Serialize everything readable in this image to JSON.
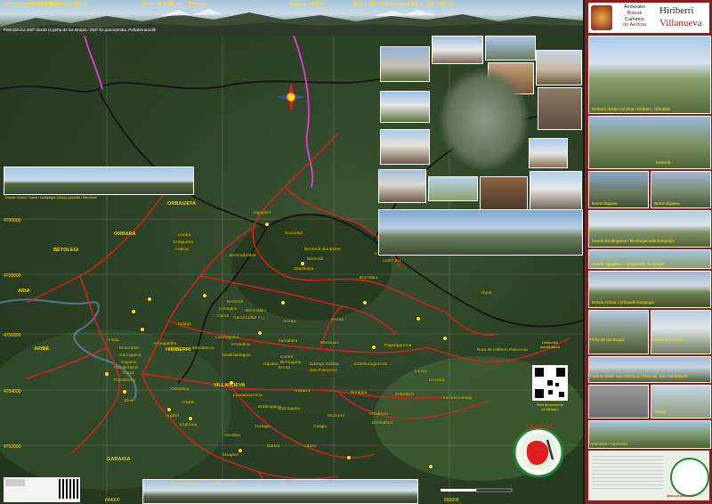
{
  "panorama": {
    "peaks": [
      {
        "name": "Orizanmuneta",
        "alt": "1.308 m"
      },
      {
        "name": "Urkulu",
        "alt": "1.419 m"
      },
      {
        "name": "Mendilaut",
        "alt": "1.252 m"
      },
      {
        "name": "Berrendi",
        "alt": "1.288 m"
      },
      {
        "name": "Pirineos",
        "alt": ""
      },
      {
        "name": "Baigura",
        "alt": "1.478 m"
      },
      {
        "name": "Elke",
        "alt": "1.263 m"
      },
      {
        "name": "La Corona",
        "alt": "1.380 m"
      },
      {
        "name": "Adi",
        "alt": "1.458 m"
      }
    ],
    "caption": "Panorámica 360º desde la peña de las Brujas / 360º ko panoramika, Peñaberaundik"
  },
  "map": {
    "grid_labels": [
      "4760000",
      "4758000",
      "4756000",
      "4754000",
      "4752000",
      "644000",
      "646000",
      "648000",
      "650000"
    ],
    "place_labels": [
      {
        "text": "ORBAIZETA",
        "color": "#ffe400",
        "weight": "bold"
      },
      {
        "text": "ORBARA",
        "color": "#ffe400",
        "weight": "bold"
      },
      {
        "text": "BETOLEGI",
        "color": "#ffe400",
        "weight": "bold"
      },
      {
        "text": "ARIA",
        "color": "#ffe400",
        "weight": "bold"
      },
      {
        "text": "ARIBE",
        "color": "#ffe400",
        "weight": "bold"
      },
      {
        "text": "GARAIOA",
        "color": "#ffe400",
        "weight": "bold"
      },
      {
        "text": "Ugagibel",
        "color": "#ffe400"
      },
      {
        "text": "Sociedad",
        "color": "#ffe400"
      },
      {
        "text": "Centro",
        "color": "#ffe400"
      },
      {
        "text": "Erdigunea",
        "color": "#ffe400"
      },
      {
        "text": "Azskoa",
        "color": "#ffe400"
      },
      {
        "text": "Berrendizolea",
        "color": "#ffe400"
      },
      {
        "text": "Berrendi Idunbidea",
        "color": "#ffe400"
      },
      {
        "text": "Austarri",
        "color": "#ffe400"
      },
      {
        "text": "Armaber Kaskoa",
        "color": "#ffe400"
      },
      {
        "text": "(1407 m.)",
        "color": "#ffe400"
      },
      {
        "text": "Berrendi",
        "color": "#ffe400"
      },
      {
        "text": "Zeazbidea",
        "color": "#ffe400"
      },
      {
        "text": "Elorzdaia",
        "color": "#ffe400"
      },
      {
        "text": "Abodi",
        "color": "#ffe400"
      },
      {
        "text": "Berrendi",
        "color": "#ffe400"
      },
      {
        "text": "Uztarakio",
        "color": "#ffe400"
      },
      {
        "text": "Gaina",
        "color": "#ffe400"
      },
      {
        "text": "Berrendiko",
        "color": "#ffe400"
      },
      {
        "text": "Gaina (1352 m.)",
        "color": "#ffe400"
      },
      {
        "text": "Artzaa",
        "color": "#ffe400"
      },
      {
        "text": "Artzaa",
        "color": "#ffe400"
      },
      {
        "text": "Eziaga",
        "color": "#ffe400"
      },
      {
        "text": "Lizartegaina",
        "color": "#ffe400"
      },
      {
        "text": "Errekalea",
        "color": "#ffe400"
      },
      {
        "text": "Iturrialdea",
        "color": "#ffe400"
      },
      {
        "text": "Marzuato",
        "color": "#ffe400"
      },
      {
        "text": "Aristia",
        "color": "#ffe400"
      },
      {
        "text": "Arrongaldea",
        "color": "#ffe400"
      },
      {
        "text": "Ebarzonte",
        "color": "#ffe400"
      },
      {
        "text": "Gatzagaina",
        "color": "#ffe400"
      },
      {
        "text": "Sagarra",
        "color": "#ffe400"
      },
      {
        "text": "HIRIBERRI",
        "color": "#ffe400",
        "weight": "bold"
      },
      {
        "text": "Mendiarrua",
        "color": "#ffe400"
      },
      {
        "text": "Pottiolerbeta",
        "color": "#ffe400"
      },
      {
        "text": "Gaina",
        "color": "#ffe400"
      },
      {
        "text": "Pottiolberro",
        "color": "#ffe400"
      },
      {
        "text": "Muskilaldegina",
        "color": "#ffe400"
      },
      {
        "text": "Hipoteo",
        "color": "#ffe400"
      },
      {
        "text": "Cortes",
        "color": "#ffe400"
      },
      {
        "text": "Berriagaria",
        "color": "#ffe400"
      },
      {
        "text": "Errota",
        "color": "#ffe400"
      },
      {
        "text": "Bazega Solana",
        "color": "#ffe400"
      },
      {
        "text": "San Francisco",
        "color": "#ffe400"
      },
      {
        "text": "Ezimburugarrena",
        "color": "#ffe400"
      },
      {
        "text": "Pagangarrena",
        "color": "#ffe400"
      },
      {
        "text": "Ruta de Hiriberri Paseeroa",
        "color": "#ffe400"
      },
      {
        "text": "Lurrea",
        "color": "#ffe400"
      },
      {
        "text": "Erreskia",
        "color": "#ffe400"
      },
      {
        "text": "VILLANUEVA",
        "color": "#ffe400",
        "weight": "bold"
      },
      {
        "text": "Odkarilea",
        "color": "#ffe400"
      },
      {
        "text": "Landabaurrena",
        "color": "#ffe400"
      },
      {
        "text": "Amparro",
        "color": "#ffe400"
      },
      {
        "text": "Beragua",
        "color": "#ffe400"
      },
      {
        "text": "Irekialdea",
        "color": "#ffe400"
      },
      {
        "text": "Antzandioaldegi",
        "color": "#ffe400"
      },
      {
        "text": "Ekia",
        "color": "#ffe400"
      },
      {
        "text": "Araiza",
        "color": "#ffe400"
      },
      {
        "text": "Bonbogaina",
        "color": "#ffe400"
      },
      {
        "text": "Argibel",
        "color": "#ffe400"
      },
      {
        "text": "Espuruaj",
        "color": "#ffe400"
      },
      {
        "text": "Bazcogaina",
        "color": "#ffe400"
      },
      {
        "text": "Motzorro",
        "color": "#ffe400"
      },
      {
        "text": "Azzaberro",
        "color": "#ffe400"
      },
      {
        "text": "Errekaldea",
        "color": "#ffe400"
      },
      {
        "text": "Tuztaga",
        "color": "#ffe400"
      },
      {
        "text": "Casgia",
        "color": "#ffe400"
      },
      {
        "text": "Atraldea",
        "color": "#ffe400"
      },
      {
        "text": "Dartea",
        "color": "#ffe400"
      },
      {
        "text": "Ardaza",
        "color": "#ffe400"
      },
      {
        "text": "Itzuighel",
        "color": "#ffe400"
      }
    ],
    "photo_captions": [
      "Desde Urkulo Gaina / Ikuspegia Urkulo gainetik / Berrendi",
      "Pirineos desde Abodi / Pirinioak, Abodi tik"
    ],
    "qr_caption_top": "Hiriberriko\nmendi sarea",
    "qr_caption_bottom": "Red de caminos\nde Hiriberri",
    "logo_text": "AEZKOA"
  },
  "right": {
    "org_lines": [
      "Aezkoako",
      "Bideak",
      "Caminos",
      "de Aezkoa"
    ],
    "title_top": "Hiriberri",
    "title_bottom": "Villanueva",
    "photo_captions": [
      "Hiriberri desde Orhokia / Hiriberri, Orhokitik",
      "Berterdi",
      "Berrendigaina",
      "Berrendigaina",
      "Desde Bonbegaina / Bonbegainetik ikuspegia",
      "Desde Ugagibel / Ugagibeldik ikuspegia",
      "Desde Artzaa / Artzaatik ikuspegia",
      "Peña de las Brujas",
      "Desde Beraberro",
      "Pirineos desde San Francisco / Pirinioak, San Frantziskotik",
      "Artzaa",
      "Atumeiza / Atumeiza"
    ],
    "website": "www.aezkoa.net"
  },
  "colors": {
    "route": "#e21d22",
    "boundary": "#111111",
    "pink_path": "#e83bd8",
    "label": "#ffe400",
    "side_panel": "#8a1d1d"
  }
}
